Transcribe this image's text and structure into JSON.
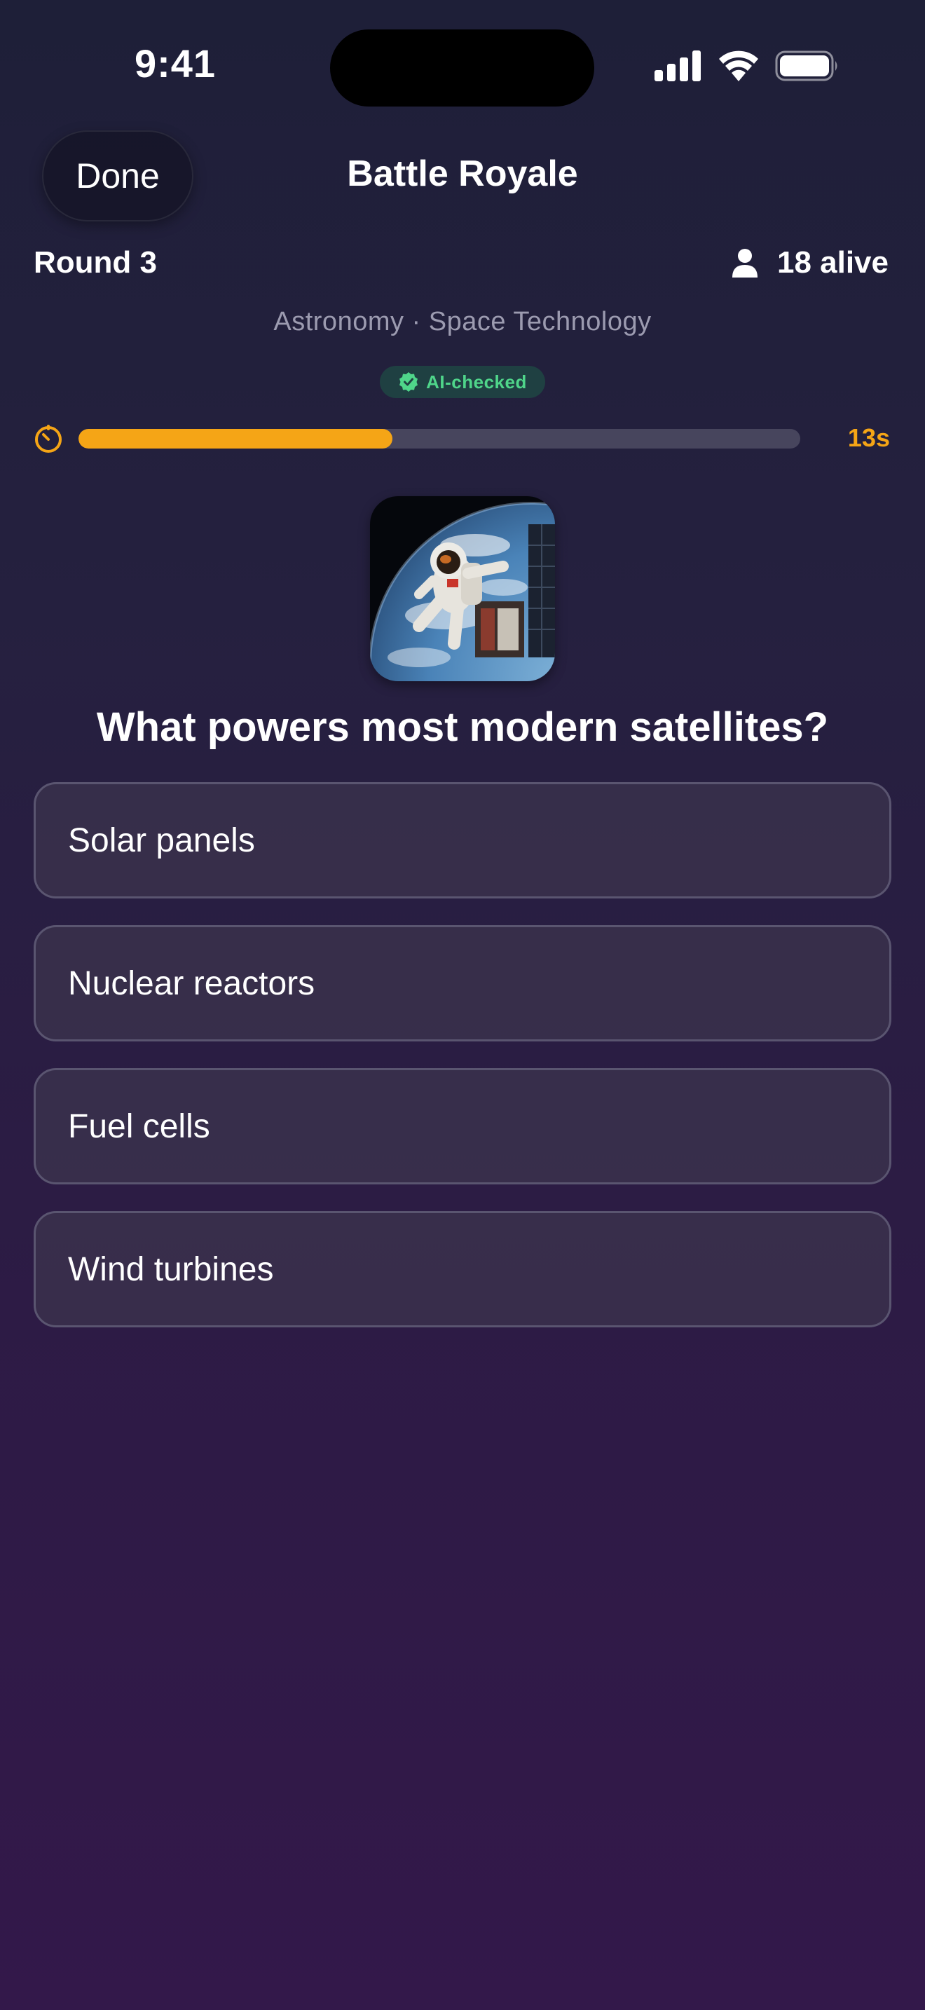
{
  "status_bar": {
    "time": "9:41"
  },
  "nav": {
    "done_label": "Done",
    "title": "Battle Royale"
  },
  "game": {
    "round_label": "Round 3",
    "alive_label": "18 alive",
    "category": "Astronomy · Space Technology",
    "badge_label": "AI-checked",
    "timer_label": "13s",
    "timer_progress": 0.435
  },
  "question": {
    "image_icon": "astronaut-image",
    "text": "What powers most modern satellites?",
    "answers": [
      {
        "label": "Solar panels"
      },
      {
        "label": "Nuclear reactors"
      },
      {
        "label": "Fuel cells"
      },
      {
        "label": "Wind turbines"
      }
    ]
  },
  "colors": {
    "accent": "#f5a516",
    "badge_text": "#4fd58a",
    "badge_bg": "#1f4042",
    "track": "#47455d"
  }
}
